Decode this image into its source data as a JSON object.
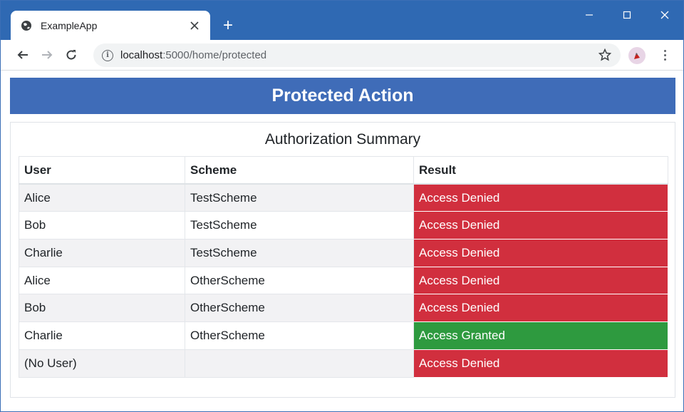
{
  "browser": {
    "tab_title": "ExampleApp",
    "new_tab_symbol": "+",
    "url_host": "localhost",
    "url_rest": ":5000/home/protected"
  },
  "page": {
    "banner_title": "Protected Action",
    "summary_title": "Authorization Summary",
    "table": {
      "headers": [
        "User",
        "Scheme",
        "Result"
      ],
      "rows": [
        {
          "user": "Alice",
          "scheme": "TestScheme",
          "result": "Access Denied",
          "status": "denied"
        },
        {
          "user": "Bob",
          "scheme": "TestScheme",
          "result": "Access Denied",
          "status": "denied"
        },
        {
          "user": "Charlie",
          "scheme": "TestScheme",
          "result": "Access Denied",
          "status": "denied"
        },
        {
          "user": "Alice",
          "scheme": "OtherScheme",
          "result": "Access Denied",
          "status": "denied"
        },
        {
          "user": "Bob",
          "scheme": "OtherScheme",
          "result": "Access Denied",
          "status": "denied"
        },
        {
          "user": "Charlie",
          "scheme": "OtherScheme",
          "result": "Access Granted",
          "status": "granted"
        },
        {
          "user": "(No User)",
          "scheme": "",
          "result": "Access Denied",
          "status": "denied"
        }
      ]
    }
  },
  "colors": {
    "titlebar": "#2f69b3",
    "banner": "#3f6cb8",
    "denied": "#d12f3e",
    "granted": "#2e9a3f"
  },
  "icons": {
    "favicon": "globe-icon",
    "close": "close-icon",
    "back": "back-arrow-icon",
    "forward": "forward-arrow-icon",
    "reload": "reload-icon",
    "info": "info-icon",
    "bookmark": "star-icon",
    "profile": "profile-avatar-icon",
    "menu": "kebab-menu-icon",
    "minimize": "minimize-icon",
    "maximize": "maximize-icon",
    "window_close": "window-close-icon"
  }
}
